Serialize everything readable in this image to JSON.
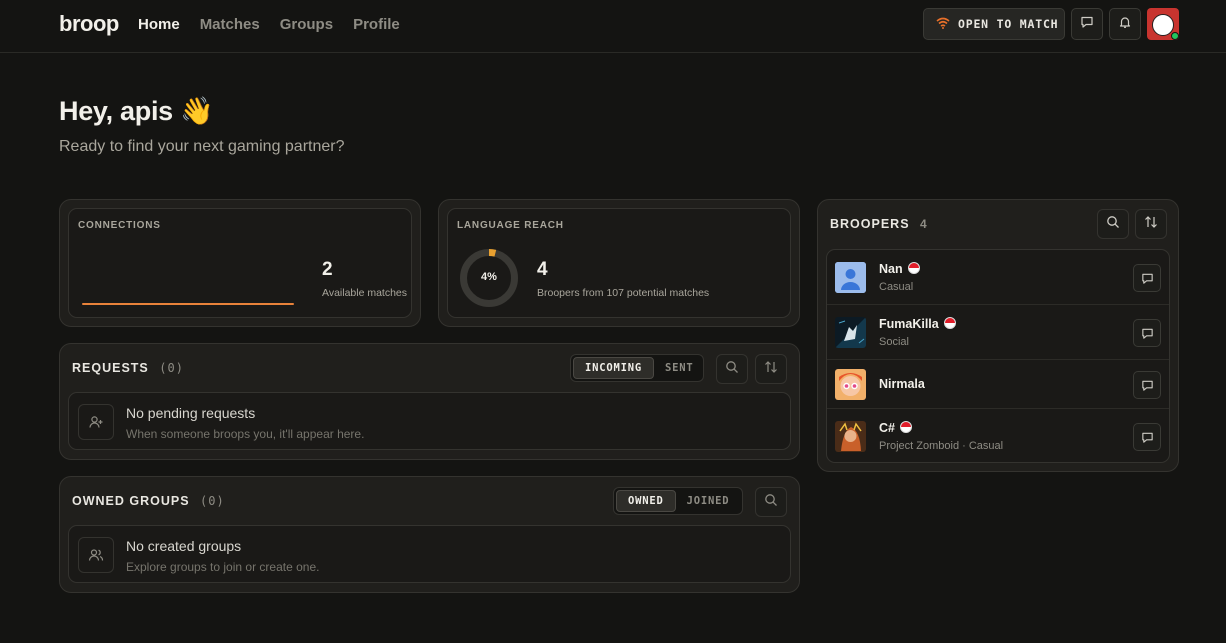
{
  "nav": {
    "logo": "broop",
    "links": [
      "Home",
      "Matches",
      "Groups",
      "Profile"
    ],
    "active": "Home",
    "open_to_match": "OPEN TO MATCH",
    "icons": [
      "wifi-icon",
      "chat-icon",
      "bell-icon",
      "avatar"
    ]
  },
  "greeting": {
    "title": "Hey, apis 👋",
    "subtitle": "Ready to find your next gaming partner?"
  },
  "connections": {
    "label": "CONNECTIONS",
    "value": "2",
    "caption": "Available matches",
    "accent_color": "#e8823a"
  },
  "language_reach": {
    "label": "LANGUAGE REACH",
    "percent_text": "4%",
    "percent": 4,
    "value": "4",
    "caption": "Broopers from 107 potential matches",
    "accent_color": "#e8a030"
  },
  "requests": {
    "title": "REQUESTS",
    "count": "(0)",
    "tabs": [
      "INCOMING",
      "SENT"
    ],
    "active_tab": "INCOMING",
    "empty_title": "No pending requests",
    "empty_sub": "When someone broops you, it'll appear here."
  },
  "owned_groups": {
    "title": "OWNED GROUPS",
    "count": "(0)",
    "tabs": [
      "OWNED",
      "JOINED"
    ],
    "active_tab": "OWNED",
    "empty_title": "No created groups",
    "empty_sub": "Explore groups to join or create one."
  },
  "broopers": {
    "title": "BROOPERS",
    "count": "4",
    "items": [
      {
        "name": "Nan",
        "sub": "Casual",
        "flag": true
      },
      {
        "name": "FumaKilla",
        "sub": "Social",
        "flag": true
      },
      {
        "name": "Nirmala",
        "sub": "",
        "flag": false
      },
      {
        "name": "C#",
        "sub": "Project Zomboid · Casual",
        "flag": true
      }
    ]
  }
}
